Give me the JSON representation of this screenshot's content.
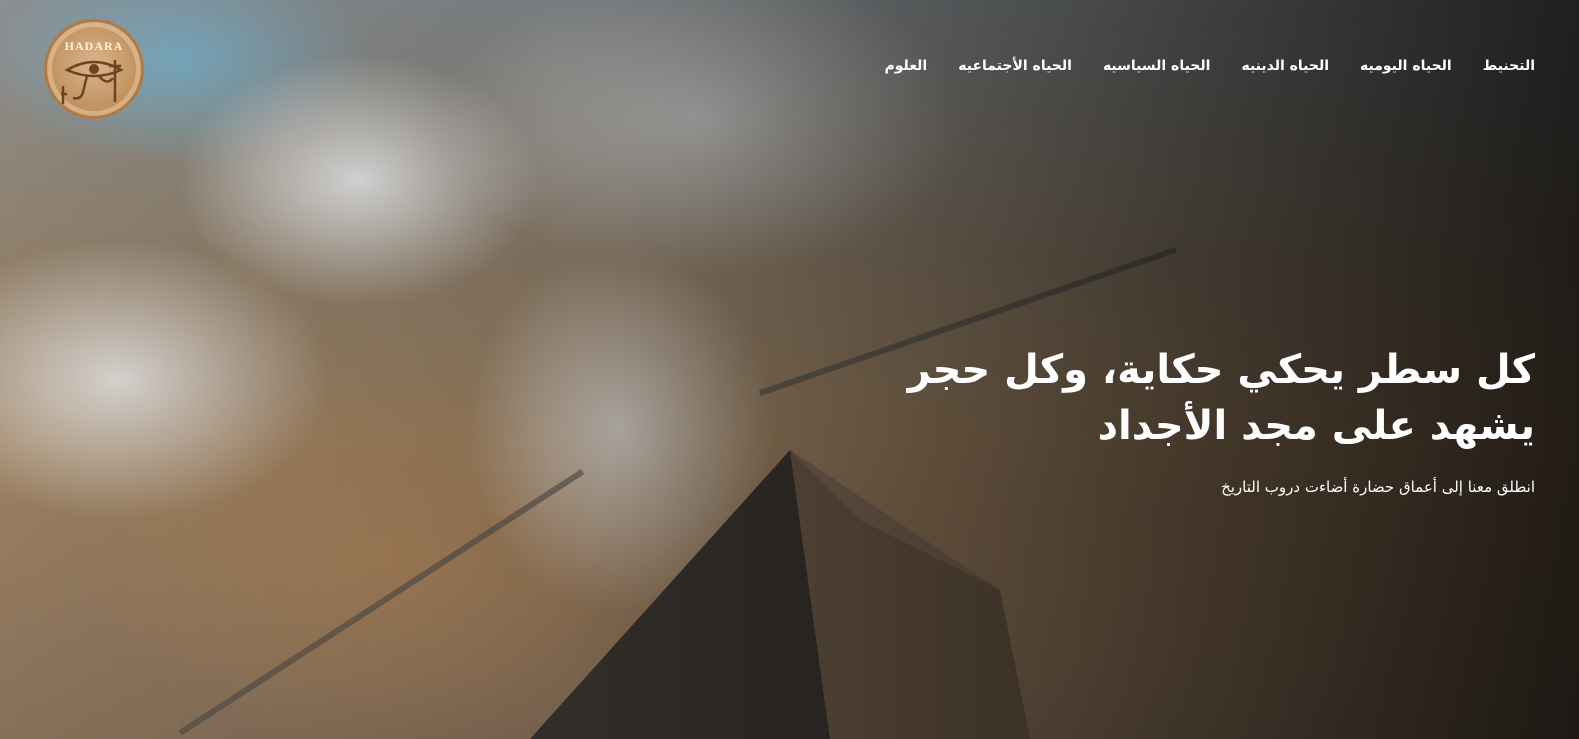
{
  "logo": {
    "text": "HADARA"
  },
  "nav": {
    "items": [
      {
        "label": "العلوم"
      },
      {
        "label": "الحياه الأجتماعيه"
      },
      {
        "label": "الحياه السياسيه"
      },
      {
        "label": "الحياه الدينيه"
      },
      {
        "label": "الحياه اليوميه"
      },
      {
        "label": "التحنيط"
      }
    ]
  },
  "hero": {
    "headline_line1": "كل سطر يحكي حكاية، وكل حجر",
    "headline_line2": "يشهد على مجد الأجداد",
    "subtitle": "انطلق معنا إلى أعماق حضارة أضاءت دروب التاريخ"
  }
}
